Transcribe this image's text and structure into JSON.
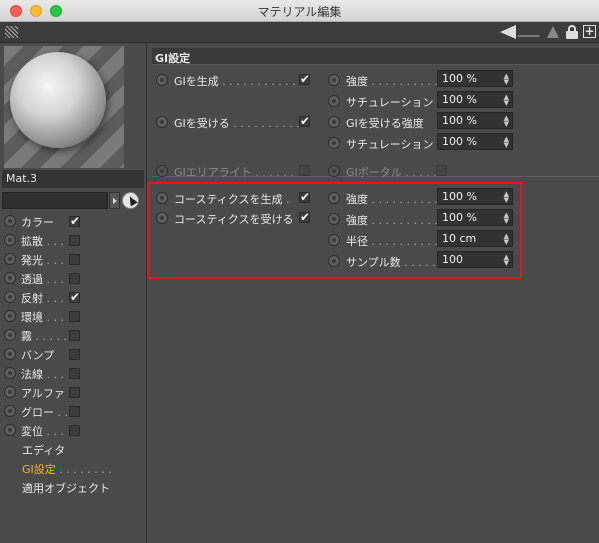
{
  "window": {
    "title": "マテリアル編集"
  },
  "material": {
    "name": "Mat.3"
  },
  "channels": [
    {
      "label": "カラー",
      "dots": "",
      "checked": true
    },
    {
      "label": "拡散",
      "dots": " . . .",
      "checked": false
    },
    {
      "label": "発光",
      "dots": " . . .",
      "checked": false
    },
    {
      "label": "透過",
      "dots": " . . .",
      "checked": false
    },
    {
      "label": "反射",
      "dots": " . . .",
      "checked": true
    },
    {
      "label": "環境",
      "dots": " . . .",
      "checked": false
    },
    {
      "label": "霧",
      "dots": " . . . . .",
      "checked": false
    },
    {
      "label": "バンプ",
      "dots": "",
      "checked": false
    },
    {
      "label": "法線",
      "dots": " . . .",
      "checked": false
    },
    {
      "label": "アルファ",
      "dots": "",
      "checked": false
    },
    {
      "label": "グロー",
      "dots": " . .",
      "checked": false
    },
    {
      "label": "変位",
      "dots": " . . .",
      "checked": false
    }
  ],
  "nav": {
    "editor": "エディタ",
    "gi_settings": "GI設定",
    "gi_settings_dots": " . . . . . . . .",
    "applied_objects": "適用オブジェクト"
  },
  "gi": {
    "section_title": "GI設定",
    "generate_label": "GIを生成",
    "generate_dots": " . . . . . . . . . . . . .",
    "generate_checked": true,
    "receive_label": "GIを受ける",
    "receive_dots": " . . . . . . . . . . .",
    "receive_checked": true,
    "strength_label": "強度",
    "strength_dots": " . . . . . . . . . . .",
    "strength_value": "100 %",
    "saturation_label": "サチュレーション",
    "saturation1_value": "100 %",
    "receive_strength_label": "GIを受ける強度",
    "receive_strength_value": "100 %",
    "saturation2_value": "100 %",
    "area_light_label": "GIエリアライト",
    "area_light_dots": " . . . . . .",
    "area_light_checked": false,
    "portal_label": "GIポータル",
    "portal_dots": " . . . . .",
    "portal_checked": false
  },
  "caustics": {
    "generate_label": "コースティクスを生成",
    "generate_dots": " .",
    "generate_checked": true,
    "receive_label": "コースティクスを受ける",
    "receive_checked": true,
    "strength1_label": "強度",
    "strength_dots": " . . . . . . . . . . .",
    "strength1_value": "100 %",
    "strength2_label": "強度",
    "strength2_value": "100 %",
    "radius_label": "半径",
    "radius_dots": " . . . . . . . . . . .",
    "radius_value": "10 cm",
    "samples_label": "サンプル数",
    "samples_dots": " . . . . .",
    "samples_value": "100"
  },
  "icons": {
    "grip": "grip-icon",
    "arrow": "back-arrow-icon",
    "lock": "lock-icon",
    "new_window": "new-window-icon",
    "cursor": "pointer-cursor-icon"
  },
  "colors": {
    "highlight_box": "#e0181c",
    "active_nav": "#f0b030"
  }
}
